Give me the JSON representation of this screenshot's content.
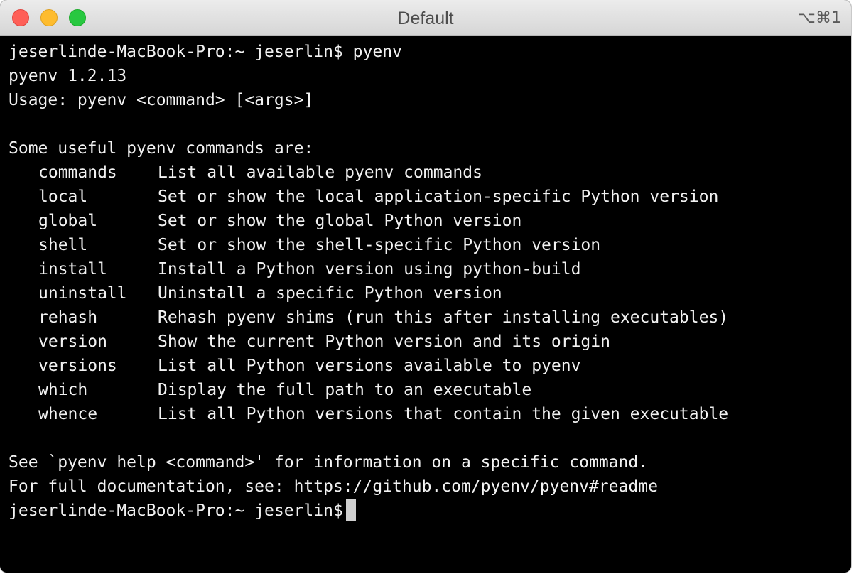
{
  "window": {
    "title": "Default",
    "shortcut": "⌥⌘1"
  },
  "terminal": {
    "prompt": "jeserlinde-MacBook-Pro:~ jeserlin$",
    "command": "pyenv",
    "version_line": "pyenv 1.2.13",
    "usage_line": "Usage: pyenv <command> [<args>]",
    "commands_header": "Some useful pyenv commands are:",
    "commands": [
      {
        "name": "commands",
        "desc": "List all available pyenv commands"
      },
      {
        "name": "local",
        "desc": "Set or show the local application-specific Python version"
      },
      {
        "name": "global",
        "desc": "Set or show the global Python version"
      },
      {
        "name": "shell",
        "desc": "Set or show the shell-specific Python version"
      },
      {
        "name": "install",
        "desc": "Install a Python version using python-build"
      },
      {
        "name": "uninstall",
        "desc": "Uninstall a specific Python version"
      },
      {
        "name": "rehash",
        "desc": "Rehash pyenv shims (run this after installing executables)"
      },
      {
        "name": "version",
        "desc": "Show the current Python version and its origin"
      },
      {
        "name": "versions",
        "desc": "List all Python versions available to pyenv"
      },
      {
        "name": "which",
        "desc": "Display the full path to an executable"
      },
      {
        "name": "whence",
        "desc": "List all Python versions that contain the given executable"
      }
    ],
    "help_line": "See `pyenv help <command>' for information on a specific command.",
    "docs_line": "For full documentation, see: https://github.com/pyenv/pyenv#readme"
  },
  "colors": {
    "background": "#000000",
    "text": "#f2f2f2",
    "close": "#fe5f57",
    "minimize": "#febc2e",
    "zoom": "#28c840"
  }
}
